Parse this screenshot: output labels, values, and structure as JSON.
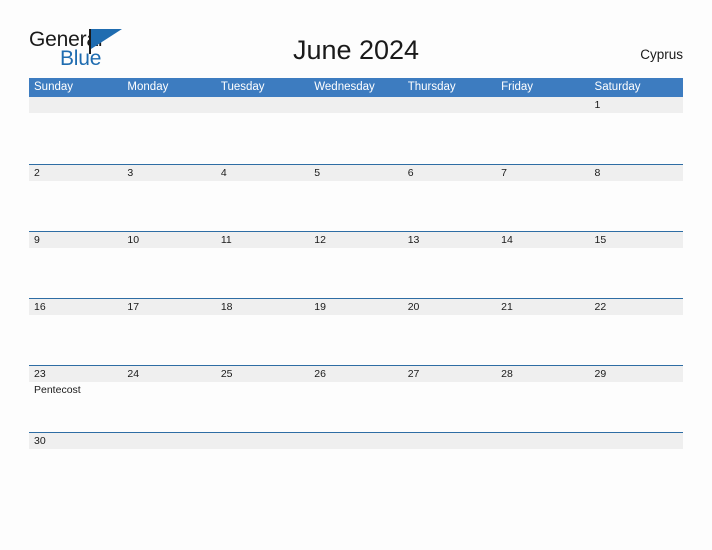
{
  "logo": {
    "word_one": "General",
    "word_two": "Blue",
    "flag_icon": "flag-triangle-icon"
  },
  "header": {
    "title": "June 2024",
    "region": "Cyprus"
  },
  "colors": {
    "header_blue": "#3d7cc0",
    "divider_blue": "#2e6da4",
    "strip_gray": "#efefef",
    "logo_blue": "#1f6cb0",
    "text_black": "#1a1a1a",
    "page_background": "#fdfdfd"
  },
  "calendar": {
    "weekday_headers": [
      "Sunday",
      "Monday",
      "Tuesday",
      "Wednesday",
      "Thursday",
      "Friday",
      "Saturday"
    ],
    "weeks": [
      {
        "days": [
          {
            "number": "",
            "events": []
          },
          {
            "number": "",
            "events": []
          },
          {
            "number": "",
            "events": []
          },
          {
            "number": "",
            "events": []
          },
          {
            "number": "",
            "events": []
          },
          {
            "number": "",
            "events": []
          },
          {
            "number": "1",
            "events": []
          }
        ]
      },
      {
        "days": [
          {
            "number": "2",
            "events": []
          },
          {
            "number": "3",
            "events": []
          },
          {
            "number": "4",
            "events": []
          },
          {
            "number": "5",
            "events": []
          },
          {
            "number": "6",
            "events": []
          },
          {
            "number": "7",
            "events": []
          },
          {
            "number": "8",
            "events": []
          }
        ]
      },
      {
        "days": [
          {
            "number": "9",
            "events": []
          },
          {
            "number": "10",
            "events": []
          },
          {
            "number": "11",
            "events": []
          },
          {
            "number": "12",
            "events": []
          },
          {
            "number": "13",
            "events": []
          },
          {
            "number": "14",
            "events": []
          },
          {
            "number": "15",
            "events": []
          }
        ]
      },
      {
        "days": [
          {
            "number": "16",
            "events": []
          },
          {
            "number": "17",
            "events": []
          },
          {
            "number": "18",
            "events": []
          },
          {
            "number": "19",
            "events": []
          },
          {
            "number": "20",
            "events": []
          },
          {
            "number": "21",
            "events": []
          },
          {
            "number": "22",
            "events": []
          }
        ]
      },
      {
        "days": [
          {
            "number": "23",
            "events": [
              "Pentecost"
            ]
          },
          {
            "number": "24",
            "events": []
          },
          {
            "number": "25",
            "events": []
          },
          {
            "number": "26",
            "events": []
          },
          {
            "number": "27",
            "events": []
          },
          {
            "number": "28",
            "events": []
          },
          {
            "number": "29",
            "events": []
          }
        ]
      },
      {
        "days": [
          {
            "number": "30",
            "events": []
          },
          {
            "number": "",
            "events": []
          },
          {
            "number": "",
            "events": []
          },
          {
            "number": "",
            "events": []
          },
          {
            "number": "",
            "events": []
          },
          {
            "number": "",
            "events": []
          },
          {
            "number": "",
            "events": []
          }
        ]
      }
    ]
  }
}
